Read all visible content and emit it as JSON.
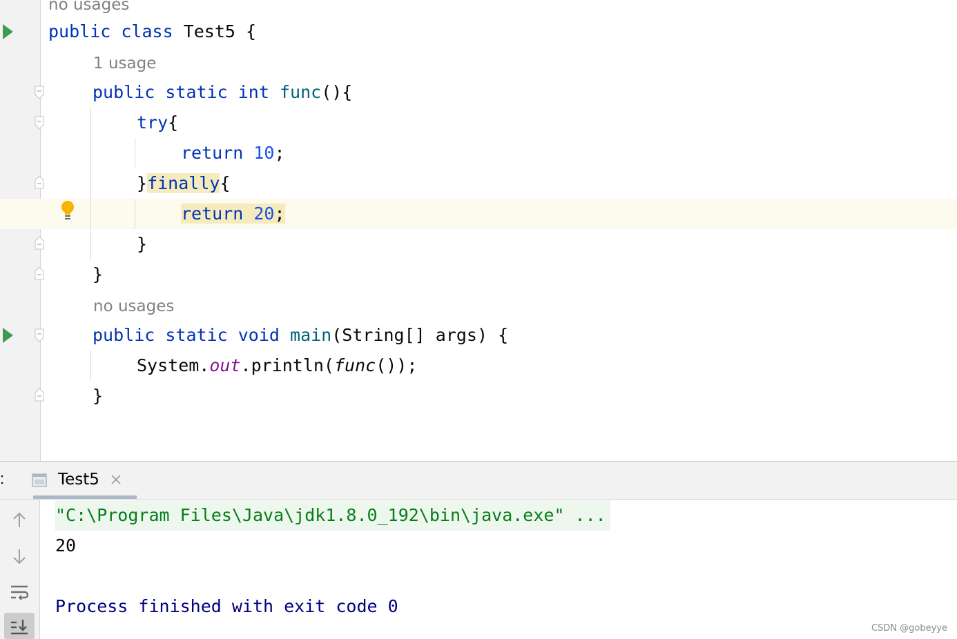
{
  "editor": {
    "hints": {
      "class_usages": "no usages",
      "func_usages": "1 usage",
      "main_usages": "no usages"
    },
    "code": {
      "l1": {
        "a": "public",
        "b": "class",
        "c": "Test5 {"
      },
      "l2": {
        "a": "public",
        "b": "static",
        "c": "int",
        "d": "func",
        "e": "(){"
      },
      "l3": {
        "a": "try",
        "b": "{"
      },
      "l4": {
        "a": "return",
        "b": "10",
        "c": ";"
      },
      "l5": {
        "a": "}",
        "b": "finally",
        "c": "{"
      },
      "l6": {
        "a": "return",
        "b": "20",
        "c": ";"
      },
      "l7": {
        "a": "}"
      },
      "l8": {
        "a": "}"
      },
      "l9": {
        "a": "public",
        "b": "static",
        "c": "void",
        "d": "main",
        "e": "(String[] args) {"
      },
      "l10": {
        "a": "System.",
        "b": "out",
        "c": ".println(",
        "d": "func",
        "e": "());"
      },
      "l11": {
        "a": "}"
      }
    }
  },
  "run_panel": {
    "colon": ":",
    "tab_label": "Test5",
    "console": {
      "command": "\"C:\\Program Files\\Java\\jdk1.8.0_192\\bin\\java.exe\" ...",
      "output": "20",
      "exit_message": "Process finished with exit code 0"
    },
    "icons": [
      "up-arrow-icon",
      "down-arrow-icon",
      "soft-wrap-icon",
      "scroll-to-end-icon"
    ]
  },
  "watermark": "CSDN @gobeyye",
  "colors": {
    "keyword": "#0033b3",
    "function": "#00627a",
    "number": "#1750eb",
    "static_field": "#871094",
    "run_green": "#3f9b52",
    "command_green": "#067d17",
    "exit_blue": "#000080",
    "current_line": "#fdfbee",
    "match_highlight": "#f6ebbc"
  }
}
